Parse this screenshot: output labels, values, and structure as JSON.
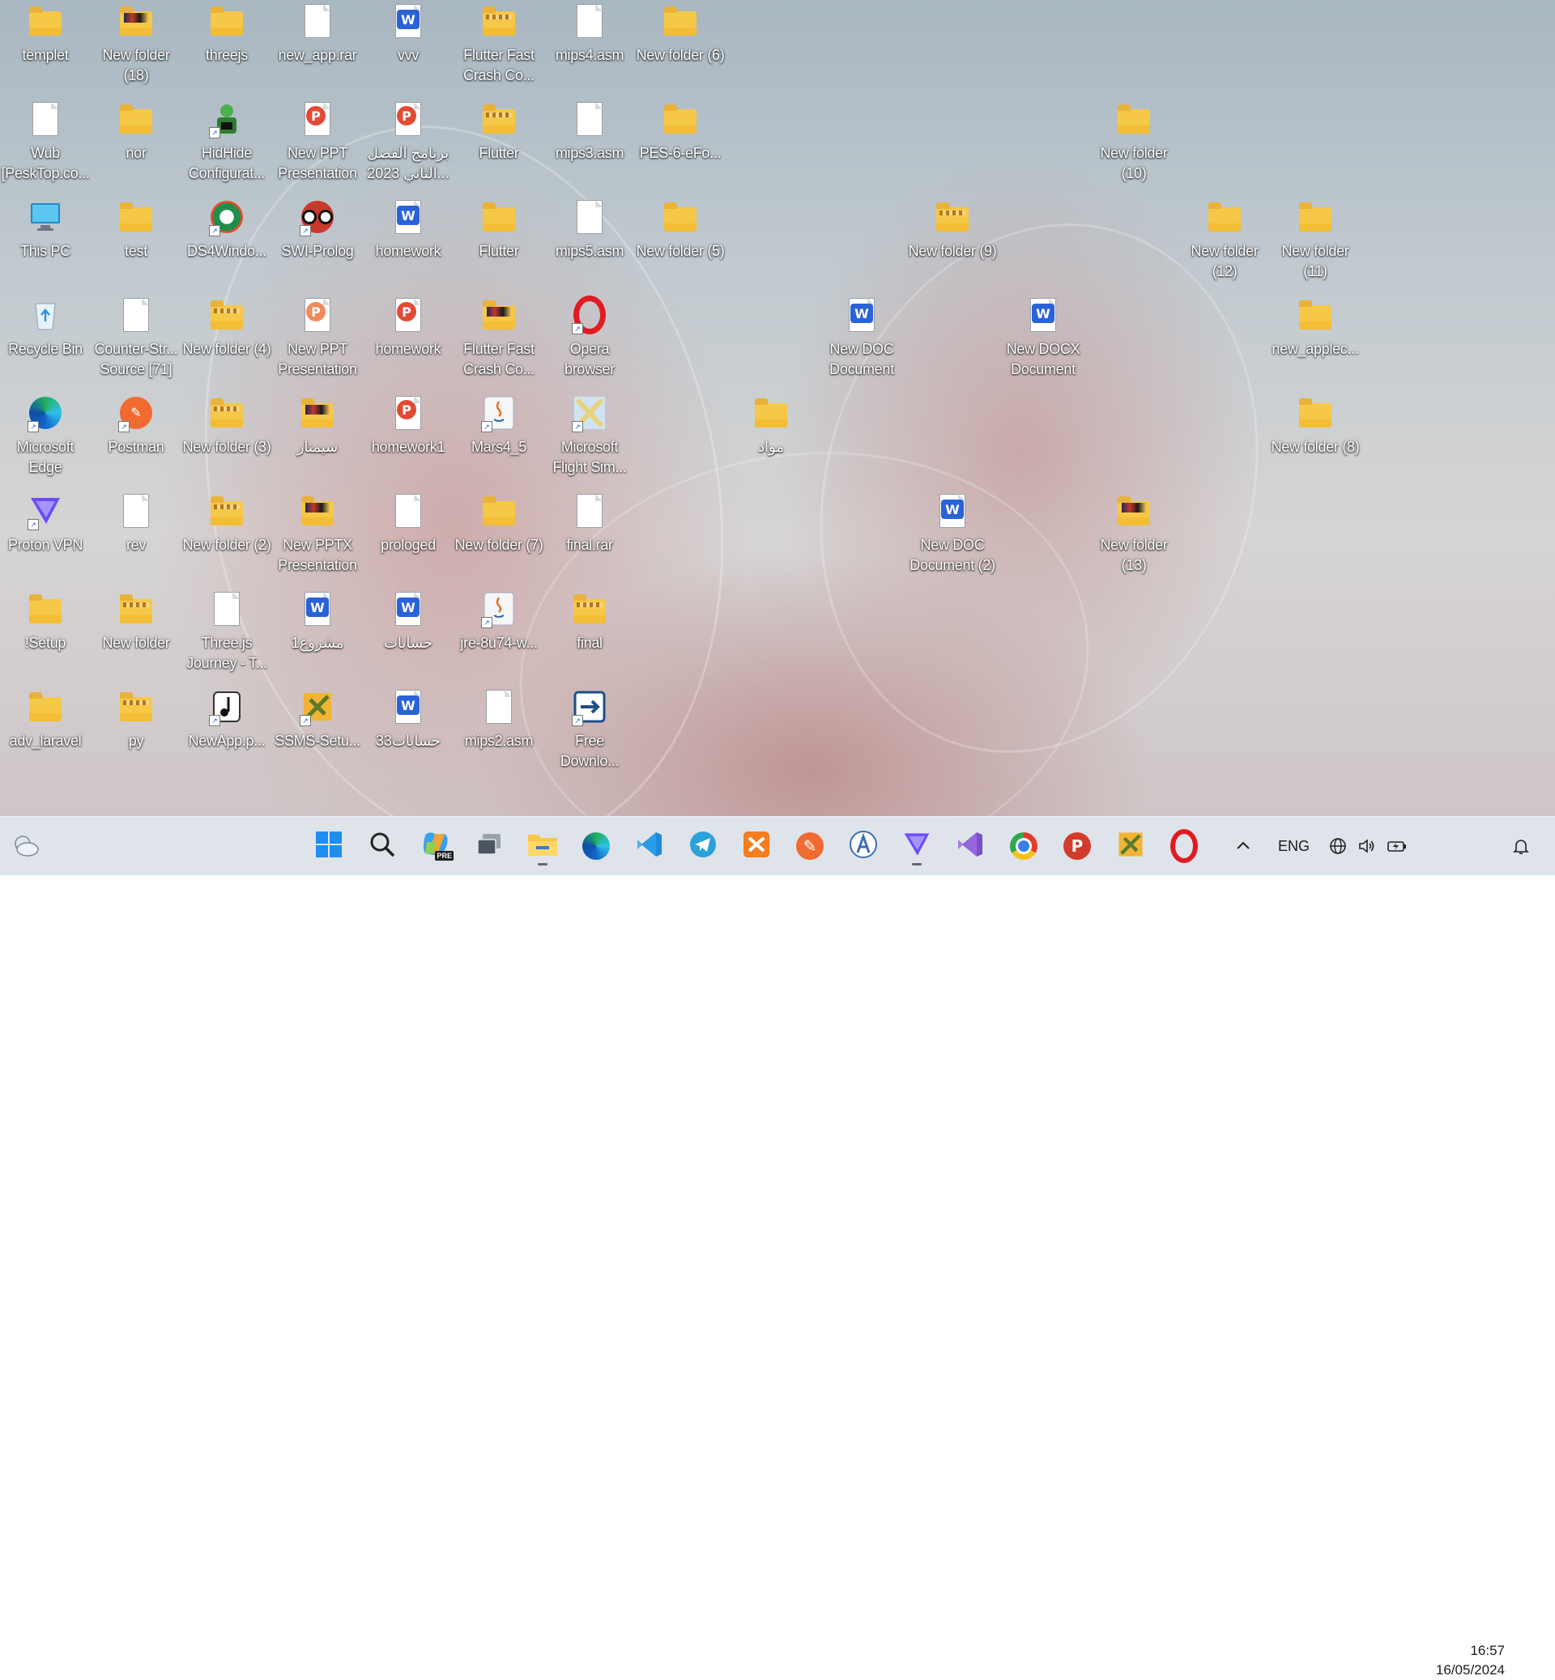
{
  "desktop": {
    "icons": [
      {
        "label": "templet",
        "kind": "folder",
        "icon": "folder-icon"
      },
      {
        "label": "New folder (18)",
        "kind": "folder-img",
        "icon": "folder-icon"
      },
      {
        "label": "threejs",
        "kind": "folder",
        "icon": "folder-icon"
      },
      {
        "label": "new_app.rar",
        "kind": "doc",
        "icon": "file-icon"
      },
      {
        "label": "vvv",
        "kind": "word",
        "icon": "word-document-icon"
      },
      {
        "label": "Flutter Fast Crash Co...",
        "kind": "folder-zip",
        "icon": "zip-folder-icon"
      },
      {
        "label": "mips4.asm",
        "kind": "doc",
        "icon": "file-icon"
      },
      {
        "label": "New folder (6)",
        "kind": "folder",
        "icon": "folder-icon"
      },
      {
        "label": "Wub [PeskTop.co...",
        "kind": "doc",
        "icon": "file-icon"
      },
      {
        "label": "nor",
        "kind": "folder",
        "icon": "folder-icon"
      },
      {
        "label": "HidHide Configurat...",
        "kind": "app-green",
        "icon": "hidhide-icon"
      },
      {
        "label": "New PPT Presentation",
        "kind": "pdf",
        "icon": "pdf-icon"
      },
      {
        "label": "برنامج الفصل الثاني 2023...",
        "kind": "pdf",
        "icon": "pdf-icon"
      },
      {
        "label": "Flutter",
        "kind": "folder-zip",
        "icon": "zip-folder-icon"
      },
      {
        "label": "mips3.asm",
        "kind": "doc",
        "icon": "file-icon"
      },
      {
        "label": "PES-6-eFo...",
        "kind": "folder",
        "icon": "folder-icon"
      },
      {
        "label": "New folder (10)",
        "kind": "folder",
        "icon": "folder-icon"
      },
      {
        "label": "This PC",
        "kind": "pc",
        "icon": "this-pc-icon"
      },
      {
        "label": "test",
        "kind": "folder",
        "icon": "folder-icon"
      },
      {
        "label": "DS4Windo...",
        "kind": "app-ds4",
        "icon": "ds4windows-icon"
      },
      {
        "label": "SWI-Prolog",
        "kind": "app-owl",
        "icon": "swi-prolog-icon"
      },
      {
        "label": "homework",
        "kind": "word",
        "icon": "word-document-icon"
      },
      {
        "label": "Flutter",
        "kind": "folder",
        "icon": "folder-icon"
      },
      {
        "label": "mips5.asm",
        "kind": "doc",
        "icon": "file-icon"
      },
      {
        "label": "New folder (5)",
        "kind": "folder",
        "icon": "folder-icon"
      },
      {
        "label": "New folder (9)",
        "kind": "folder-zip",
        "icon": "folder-icon"
      },
      {
        "label": "New folder (12)",
        "kind": "folder",
        "icon": "folder-icon"
      },
      {
        "label": "New folder (11)",
        "kind": "folder",
        "icon": "folder-icon"
      },
      {
        "label": "Recycle Bin",
        "kind": "bin",
        "icon": "recycle-bin-icon"
      },
      {
        "label": "Counter-Str... Source [71]",
        "kind": "doc",
        "icon": "shortcut-file-icon"
      },
      {
        "label": "New folder (4)",
        "kind": "folder-zip",
        "icon": "folder-icon"
      },
      {
        "label": "New PPT Presentation",
        "kind": "pdfo",
        "icon": "powerpoint-icon"
      },
      {
        "label": "homework",
        "kind": "pdf",
        "icon": "pdf-icon"
      },
      {
        "label": "Flutter Fast Crash Co...",
        "kind": "folder-img",
        "icon": "folder-icon"
      },
      {
        "label": "Opera browser",
        "kind": "opera",
        "icon": "opera-icon"
      },
      {
        "label": "New DOC Document",
        "kind": "word",
        "icon": "word-document-icon"
      },
      {
        "label": "New DOCX Document",
        "kind": "word",
        "icon": "word-document-icon"
      },
      {
        "label": "new_applec...",
        "kind": "folder",
        "icon": "folder-icon"
      },
      {
        "label": "Microsoft Edge",
        "kind": "edge",
        "icon": "edge-icon"
      },
      {
        "label": "Postman",
        "kind": "postman",
        "icon": "postman-icon"
      },
      {
        "label": "New folder (3)",
        "kind": "folder-zip",
        "icon": "folder-icon"
      },
      {
        "label": "سيمنار",
        "kind": "folder-img",
        "icon": "folder-icon"
      },
      {
        "label": "homework1",
        "kind": "pdf",
        "icon": "pdf-icon"
      },
      {
        "label": "Mars4_5",
        "kind": "java",
        "icon": "java-icon"
      },
      {
        "label": "Microsoft Flight Sim...",
        "kind": "app-fs",
        "icon": "flight-simulator-icon"
      },
      {
        "label": "مواد",
        "kind": "folder",
        "icon": "folder-icon"
      },
      {
        "label": "New folder (8)",
        "kind": "folder",
        "icon": "folder-icon"
      },
      {
        "label": "Proton VPN",
        "kind": "proton",
        "icon": "proton-vpn-icon"
      },
      {
        "label": "rev",
        "kind": "doc",
        "icon": "settings-file-icon"
      },
      {
        "label": "New folder (2)",
        "kind": "folder-zip",
        "icon": "folder-icon"
      },
      {
        "label": "New PPTX Presentation",
        "kind": "folder-img",
        "icon": "pptx-icon"
      },
      {
        "label": "prologed",
        "kind": "doc",
        "icon": "file-icon"
      },
      {
        "label": "New folder (7)",
        "kind": "folder",
        "icon": "folder-icon"
      },
      {
        "label": "final.rar",
        "kind": "doc",
        "icon": "file-icon"
      },
      {
        "label": "New DOC Document (2)",
        "kind": "word",
        "icon": "word-document-icon"
      },
      {
        "label": "New folder (13)",
        "kind": "folder-img",
        "icon": "folder-icon"
      },
      {
        "label": "!Setup",
        "kind": "folder",
        "icon": "folder-icon"
      },
      {
        "label": "New folder",
        "kind": "folder-zip",
        "icon": "folder-icon"
      },
      {
        "label": "Three.js Journey - T...",
        "kind": "doc",
        "icon": "file-icon"
      },
      {
        "label": "مشروع1",
        "kind": "word",
        "icon": "word-document-icon"
      },
      {
        "label": "حسابات",
        "kind": "word",
        "icon": "word-document-icon"
      },
      {
        "label": "jre-8u74-w...",
        "kind": "java",
        "icon": "java-installer-icon"
      },
      {
        "label": "final",
        "kind": "folder-zip",
        "icon": "folder-icon"
      },
      {
        "label": "adv_laravel",
        "kind": "folder",
        "icon": "folder-icon"
      },
      {
        "label": "py",
        "kind": "folder-zip",
        "icon": "folder-icon"
      },
      {
        "label": "NewApp.p...",
        "kind": "app-music",
        "icon": "music-file-icon"
      },
      {
        "label": "SSMS-Setu...",
        "kind": "app-ssms",
        "icon": "ssms-setup-icon"
      },
      {
        "label": "33حسابات",
        "kind": "word",
        "icon": "word-document-icon"
      },
      {
        "label": "mips2.asm",
        "kind": "doc",
        "icon": "file-icon"
      },
      {
        "label": "Free Downlo...",
        "kind": "app-fdm",
        "icon": "free-download-manager-icon"
      }
    ]
  },
  "taskbar": {
    "apps": [
      {
        "name": "start-button",
        "icon": "windows-start-icon"
      },
      {
        "name": "search-button",
        "icon": "search-icon"
      },
      {
        "name": "copilot-button",
        "icon": "copilot-icon",
        "badge": "PRE"
      },
      {
        "name": "task-view-button",
        "icon": "task-view-icon"
      },
      {
        "name": "file-explorer-button",
        "icon": "file-explorer-icon"
      },
      {
        "name": "edge-button",
        "icon": "edge-icon"
      },
      {
        "name": "vscode-button",
        "icon": "vscode-icon"
      },
      {
        "name": "telegram-button",
        "icon": "telegram-icon"
      },
      {
        "name": "xampp-button",
        "icon": "xampp-icon"
      },
      {
        "name": "postman-button",
        "icon": "postman-icon"
      },
      {
        "name": "android-studio-button",
        "icon": "android-studio-icon"
      },
      {
        "name": "proton-vpn-button",
        "icon": "proton-vpn-icon"
      },
      {
        "name": "visual-studio-button",
        "icon": "visual-studio-icon"
      },
      {
        "name": "chrome-button",
        "icon": "chrome-icon"
      },
      {
        "name": "powerpoint-button",
        "icon": "powerpoint-icon"
      },
      {
        "name": "ssms-button",
        "icon": "ssms-icon"
      },
      {
        "name": "opera-button",
        "icon": "opera-icon"
      }
    ],
    "language": "ENG",
    "time": "16:57",
    "date": "16/05/2024"
  }
}
